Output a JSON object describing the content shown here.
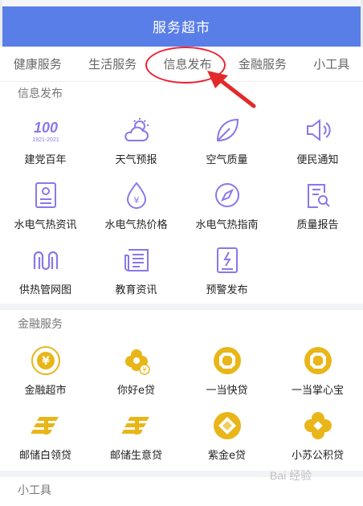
{
  "header": {
    "title": "服务超市"
  },
  "tabs": [
    {
      "label": "健康服务"
    },
    {
      "label": "生活服务"
    },
    {
      "label": "信息发布"
    },
    {
      "label": "金融服务"
    },
    {
      "label": "小工具"
    }
  ],
  "info": {
    "title": "信息发布",
    "items": [
      {
        "label": "建党百年",
        "icon": "party-centennial-icon",
        "badge": "1921-2021"
      },
      {
        "label": "天气预报",
        "icon": "weather-icon"
      },
      {
        "label": "空气质量",
        "icon": "leaf-icon"
      },
      {
        "label": "便民通知",
        "icon": "speaker-icon"
      },
      {
        "label": "水电气热资讯",
        "icon": "document-icon"
      },
      {
        "label": "水电气热价格",
        "icon": "price-drop-icon"
      },
      {
        "label": "水电气热指南",
        "icon": "compass-icon"
      },
      {
        "label": "质量报告",
        "icon": "report-search-icon"
      },
      {
        "label": "供热管网图",
        "icon": "pipe-network-icon"
      },
      {
        "label": "教育资讯",
        "icon": "news-icon"
      },
      {
        "label": "预警发布",
        "icon": "warning-doc-icon"
      }
    ]
  },
  "finance": {
    "title": "金融服务",
    "items": [
      {
        "label": "金融超市",
        "icon": "yuan-coin-icon"
      },
      {
        "label": "你好e贷",
        "icon": "flower-coin-icon"
      },
      {
        "label": "一当快贷",
        "icon": "octagon-coin-icon"
      },
      {
        "label": "一当掌心宝",
        "icon": "octagon-coin-icon"
      },
      {
        "label": "邮储白领贷",
        "icon": "postal-logo-icon"
      },
      {
        "label": "邮储生意贷",
        "icon": "postal-logo-icon"
      },
      {
        "label": "紫金e贷",
        "icon": "gem-coin-icon"
      },
      {
        "label": "小苏公积贷",
        "icon": "clover-coin-icon"
      }
    ]
  },
  "tools": {
    "title": "小工具"
  },
  "watermark": {
    "text": "Bai 经验"
  },
  "colors": {
    "accent": "#5a7ee8",
    "icon": "#8a78e8",
    "gold": "#e8b618",
    "annotation": "#e22a2a"
  }
}
